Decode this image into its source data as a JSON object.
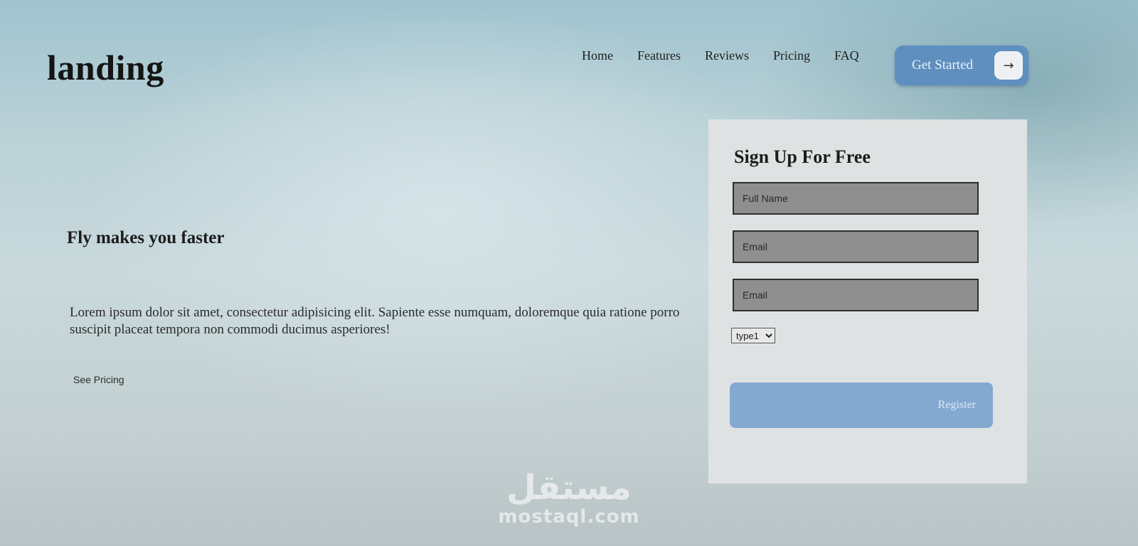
{
  "header": {
    "logo": "landing",
    "nav": [
      "Home",
      "Features",
      "Reviews",
      "Pricing",
      "FAQ"
    ],
    "cta_label": "Get Started",
    "cta_icon": "arrow-right-icon"
  },
  "hero": {
    "title": "Fly makes you faster",
    "text": "Lorem ipsum dolor sit amet, consectetur adipisicing elit. Sapiente esse numquam, doloremque quia ratione porro suscipit placeat tempora non commodi ducimus asperiores!",
    "link": "See Pricing"
  },
  "signup": {
    "title": "Sign Up For Free",
    "fields": [
      {
        "placeholder": "Full Name",
        "value": ""
      },
      {
        "placeholder": "Email",
        "value": ""
      },
      {
        "placeholder": "Email",
        "value": ""
      }
    ],
    "select_value": "type1",
    "register_label": "Register"
  },
  "watermark": {
    "arabic": "مستقل",
    "latin": "mostaql.com"
  },
  "colors": {
    "cta": "#5f8fbf",
    "register": "#84a9d0",
    "input_bg": "#8f8f8f",
    "card_bg": "#dfe2e3"
  }
}
